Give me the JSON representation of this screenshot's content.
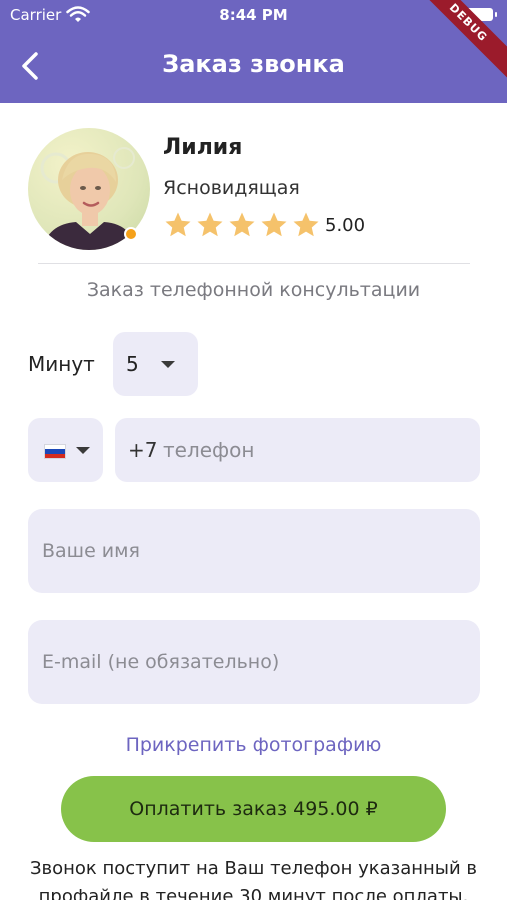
{
  "status_bar": {
    "carrier": "Carrier",
    "time": "8:44 PM"
  },
  "app_bar": {
    "title": "Заказ звонка",
    "debug_banner": "DEBUG",
    "color": "#6d65c0"
  },
  "psychic": {
    "name": "Лилия",
    "specialty": "Ясновидящая",
    "rating": "5.00",
    "stars": 5,
    "online_indicator_color": "#f5a11a"
  },
  "form": {
    "subtitle": "Заказ телефонной консультации",
    "minutes_label": "Минут",
    "minutes_value": "5",
    "country_flag": "russia-flag",
    "phone_code": "+7",
    "phone_placeholder": "телефон",
    "name_placeholder": "Ваше имя",
    "email_placeholder": "E-mail (не обязательно)",
    "attach_photo": "Прикрепить фотографию",
    "pay_button": "Оплатить заказ 495.00 ₽",
    "note": "Звонок поступит на Ваш телефон указанный в профайле в течение 30 минут после оплаты. Для"
  },
  "colors": {
    "accent": "#6d65c0",
    "pay_button": "#87c24a",
    "field_bg": "#ecebf7",
    "star": "#f5c26b"
  }
}
